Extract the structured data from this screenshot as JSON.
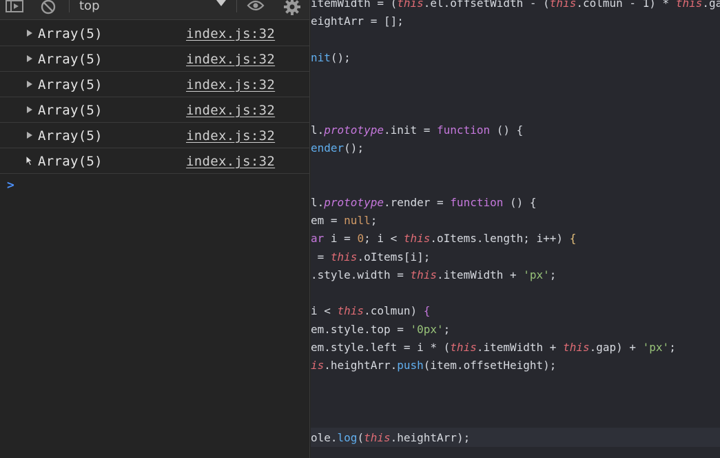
{
  "toolbar": {
    "context": "top"
  },
  "console": {
    "logs": [
      {
        "value": "Array(5)",
        "source": "index.js:32"
      },
      {
        "value": "Array(5)",
        "source": "index.js:32"
      },
      {
        "value": "Array(5)",
        "source": "index.js:32"
      },
      {
        "value": "Array(5)",
        "source": "index.js:32"
      },
      {
        "value": "Array(5)",
        "source": "index.js:32"
      },
      {
        "value": "Array(5)",
        "source": "index.js:32"
      }
    ],
    "prompt": ">"
  },
  "editor": {
    "lines": [
      [
        [
          "",
          "itemWidth = ("
        ],
        [
          "th",
          "this"
        ],
        [
          "",
          ".el.offsetWidth - ("
        ],
        [
          "th",
          "this"
        ],
        [
          "",
          ".colmun - 1) * "
        ],
        [
          "th",
          "this"
        ],
        [
          "",
          ".gap"
        ]
      ],
      [
        [
          "",
          "eightArr = [];"
        ]
      ],
      [],
      [
        [
          "fn",
          "nit"
        ],
        [
          "",
          "();"
        ]
      ],
      [],
      [],
      [],
      [
        [
          "",
          "l."
        ],
        [
          "pr",
          "prototype"
        ],
        [
          "",
          ".init = "
        ],
        [
          "kw",
          "function"
        ],
        [
          "",
          " () {"
        ]
      ],
      [
        [
          "fn",
          "ender"
        ],
        [
          "",
          "();"
        ]
      ],
      [],
      [],
      [
        [
          "",
          "l."
        ],
        [
          "pr",
          "prototype"
        ],
        [
          "",
          ".render = "
        ],
        [
          "kw",
          "function"
        ],
        [
          "",
          " () {"
        ]
      ],
      [
        [
          "",
          "em = "
        ],
        [
          "nu",
          "null"
        ],
        [
          "",
          ";"
        ]
      ],
      [
        [
          "kw",
          "ar"
        ],
        [
          "",
          " i = "
        ],
        [
          "nu",
          "0"
        ],
        [
          "",
          "; i < "
        ],
        [
          "th",
          "this"
        ],
        [
          "",
          ".oItems.length; i++) "
        ],
        [
          "br",
          "{"
        ]
      ],
      [
        [
          "",
          " = "
        ],
        [
          "th",
          "this"
        ],
        [
          "",
          ".oItems[i];"
        ]
      ],
      [
        [
          "",
          ".style.width = "
        ],
        [
          "th",
          "this"
        ],
        [
          "",
          ".itemWidth + "
        ],
        [
          "st",
          "'px'"
        ],
        [
          "",
          ";"
        ]
      ],
      [],
      [
        [
          "",
          "i < "
        ],
        [
          "th",
          "this"
        ],
        [
          "",
          ".colmun) "
        ],
        [
          "kw",
          "{"
        ]
      ],
      [
        [
          "",
          "em.style.top = "
        ],
        [
          "st",
          "'0px'"
        ],
        [
          "",
          ";"
        ]
      ],
      [
        [
          "",
          "em.style.left = i * ("
        ],
        [
          "th",
          "this"
        ],
        [
          "",
          ".itemWidth + "
        ],
        [
          "th",
          "this"
        ],
        [
          "",
          ".gap) + "
        ],
        [
          "st",
          "'px'"
        ],
        [
          "",
          ";"
        ]
      ],
      [
        [
          "th",
          "is"
        ],
        [
          "",
          ".heightArr."
        ],
        [
          "fn",
          "push"
        ],
        [
          "",
          "(item.offsetHeight);"
        ]
      ],
      [],
      [],
      [],
      [
        [
          "",
          "ole."
        ],
        [
          "fn",
          "log"
        ],
        [
          "",
          "("
        ],
        [
          "th",
          "this"
        ],
        [
          "",
          ".heightArr);"
        ]
      ]
    ]
  }
}
